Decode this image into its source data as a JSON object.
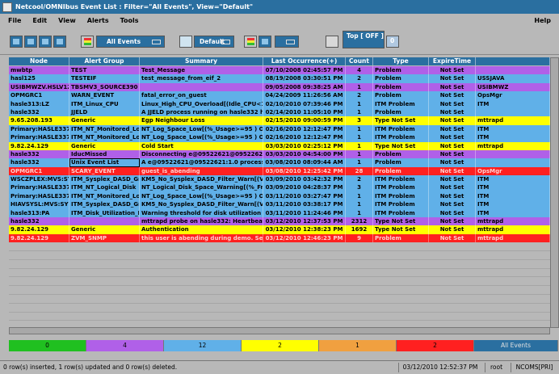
{
  "window": {
    "title": "Netcool/OMNIbus Event List : Filter=\"All Events\", View=\"Default\""
  },
  "menu": {
    "file": "File",
    "edit": "Edit",
    "view": "View",
    "alerts": "Alerts",
    "tools": "Tools",
    "help": "Help"
  },
  "toolbar": {
    "filter": "All Events",
    "view": "Default",
    "top": "Top [ OFF ]",
    "top_value": "0"
  },
  "colors": {
    "purple": "#b060e8",
    "blue": "#60b0e8",
    "yellow": "#ffff00",
    "orange": "#f0a040",
    "red": "#ff2020",
    "green": "#20c020",
    "header": "#2a6fa0"
  },
  "columns": [
    "Node",
    "Alert Group",
    "Summary",
    "Last Occurrence(+)",
    "Count",
    "Type",
    "ExpireTime",
    ""
  ],
  "rows": [
    {
      "sev": "purple",
      "node": "mwbtp",
      "group": "TEST",
      "summary": "Test_Message",
      "last": "07/10/2008 02:45:57 PM",
      "count": "4",
      "type": "Problem",
      "expire": "Not Set",
      "extra": ""
    },
    {
      "sev": "blue",
      "node": "hasl125",
      "group": "TESTEIF",
      "summary": "test_message_from_eif_2",
      "last": "08/19/2008 03:30:51 PM",
      "count": "2",
      "type": "Problem",
      "expire": "Not Set",
      "extra": "USSJAVA"
    },
    {
      "sev": "purple",
      "node": "USIBMWZV.HSLV12",
      "group": "TBSMV3_SOURCE390",
      "summary": "",
      "last": "09/05/2008 09:38:25 AM",
      "count": "1",
      "type": "Problem",
      "expire": "Not Set",
      "extra": "USIBMWZ"
    },
    {
      "sev": "blue",
      "node": "OPMGRC1",
      "group": "WARN_EVENT",
      "summary": "fatal_error_on_guest",
      "last": "04/24/2009 11:26:56 AM",
      "count": "2",
      "type": "Problem",
      "expire": "Not Set",
      "extra": "OpsMgr"
    },
    {
      "sev": "blue",
      "node": "hasle313:LZ",
      "group": "ITM_Linux_CPU",
      "summary": "Linux_High_CPU_Overload[(Idle_CPU<10.",
      "last": "02/10/2010 07:39:46 PM",
      "count": "1",
      "type": "ITM Problem",
      "expire": "Not Set",
      "extra": "ITM"
    },
    {
      "sev": "blue",
      "node": "hasle332",
      "group": "JJELD",
      "summary": "A JJELD process  running on hasle332 ha",
      "last": "02/14/2010 11:05:10 PM",
      "count": "1",
      "type": "Problem",
      "expire": "Not Set",
      "extra": ""
    },
    {
      "sev": "yellow",
      "node": "9.65.208.193",
      "group": "Generic",
      "summary": "Egp Neighbour Loss",
      "last": "02/15/2010 09:00:59 PM",
      "count": "3",
      "type": "Type Not Set",
      "expire": "Not Set",
      "extra": "mttrapd"
    },
    {
      "sev": "blue",
      "node": "Primary:HASLE337:",
      "group": "ITM_NT_Monitored_Log",
      "summary": "NT_Log_Space_Low[(%_Usage>=95 ) ON",
      "last": "02/16/2010 12:12:47 PM",
      "count": "1",
      "type": "ITM Problem",
      "expire": "Not Set",
      "extra": "ITM"
    },
    {
      "sev": "blue",
      "node": "Primary:HASLE337:",
      "group": "ITM_NT_Monitored_Log",
      "summary": "NT_Log_Space_Low[(%_Usage>=95 ) ON",
      "last": "02/16/2010 12:12:47 PM",
      "count": "1",
      "type": "ITM Problem",
      "expire": "Not Set",
      "extra": "ITM"
    },
    {
      "sev": "yellow",
      "node": "9.82.24.129",
      "group": "Generic",
      "summary": "Cold Start",
      "last": "03/03/2010 02:25:12 PM",
      "count": "1",
      "type": "Type Not Set",
      "expire": "Not Set",
      "extra": "mttrapd"
    },
    {
      "sev": "purple",
      "node": "hasle332",
      "group": "IducMissed",
      "summary": "Disconnecting e@09522621@09522621:1.",
      "last": "03/03/2010 04:54:00 PM",
      "count": "1",
      "type": "Problem",
      "expire": "Not Set",
      "extra": ""
    },
    {
      "sev": "blue",
      "node": "hasle332",
      "group": "Unix Event List",
      "summary": "A e@09522621@09522621:1.0 process e",
      "last": "03/08/2010 08:09:44 AM",
      "count": "1",
      "type": "Problem",
      "expire": "Not Set",
      "extra": ""
    },
    {
      "sev": "red",
      "node": "OPMGRC1",
      "group": "SCARY_EVENT",
      "summary": "guest_is_abending",
      "last": "03/08/2010 12:25:42 PM",
      "count": "28",
      "type": "Problem",
      "expire": "Not Set",
      "extra": "OpsMgr"
    },
    {
      "sev": "blue",
      "node": "WSCZPLEX:MVS:SY",
      "group": "ITM_Sysplex_DASD_Gr",
      "summary": "KM5_No_Sysplex_DASD_Filter_Warn[(Vol",
      "last": "03/09/2010 03:42:32 PM",
      "count": "2",
      "type": "ITM Problem",
      "expire": "Not Set",
      "extra": "ITM"
    },
    {
      "sev": "blue",
      "node": "Primary:HASLE337:",
      "group": "ITM_NT_Logical_Disk",
      "summary": "NT_Logical_Disk_Space_Warning[(%_Fre",
      "last": "03/09/2010 04:28:37 PM",
      "count": "3",
      "type": "ITM Problem",
      "expire": "Not Set",
      "extra": "ITM"
    },
    {
      "sev": "blue",
      "node": "Primary:HASLE337:",
      "group": "ITM_NT_Monitored_Log",
      "summary": "NT_Log_Space_Low[(%_Usage>=95 ) ON",
      "last": "03/11/2010 03:27:47 PM",
      "count": "1",
      "type": "ITM Problem",
      "expire": "Not Set",
      "extra": "ITM"
    },
    {
      "sev": "blue",
      "node": "HIAVSYSL:MVS:SY",
      "group": "ITM_Sysplex_DASD_Gr",
      "summary": "KM5_No_Sysplex_DASD_Filter_Warn[(Vol",
      "last": "03/11/2010 03:38:17 PM",
      "count": "1",
      "type": "ITM Problem",
      "expire": "Not Set",
      "extra": "ITM"
    },
    {
      "sev": "blue",
      "node": "hasle313:PA",
      "group": "ITM_Disk_Utilization_LT",
      "summary": "Warning threshold for disk utilization on o",
      "last": "03/11/2010 11:24:46 PM",
      "count": "1",
      "type": "ITM Problem",
      "expire": "Not Set",
      "extra": "ITM"
    },
    {
      "sev": "purple",
      "node": "hasle332",
      "group": "",
      "summary": "mttrapd probe on hasle332: Heartbeat Me",
      "last": "03/12/2010 12:37:53 PM",
      "count": "2312",
      "type": "Type Not Set",
      "expire": "Not Set",
      "extra": "mttrapd"
    },
    {
      "sev": "yellow",
      "node": "9.82.24.129",
      "group": "Generic",
      "summary": "Authentication",
      "last": "03/12/2010 12:38:23 PM",
      "count": "1692",
      "type": "Type Not Set",
      "expire": "Not Set",
      "extra": "mttrapd"
    },
    {
      "sev": "red",
      "node": "9.82.24.129",
      "group": "ZVM_SNMP",
      "summary": " this user is abending during demo. Seno",
      "last": "03/12/2010 12:46:23 PM",
      "count": "9",
      "type": "Problem",
      "expire": "Not Set",
      "extra": "mttrapd"
    }
  ],
  "summary_bar": [
    {
      "label": "0",
      "color": "#20c020"
    },
    {
      "label": "4",
      "color": "#b060e8"
    },
    {
      "label": "12",
      "color": "#60b0e8"
    },
    {
      "label": "2",
      "color": "#ffff00"
    },
    {
      "label": "1",
      "color": "#f0a040"
    },
    {
      "label": "2",
      "color": "#ff2020"
    },
    {
      "label": "All Events",
      "color": "#2a6fa0"
    }
  ],
  "status": {
    "message": "0 row(s) inserted, 1 row(s) updated and 0 row(s) deleted.",
    "time": "03/12/2010 12:52:37 PM",
    "user": "root",
    "server": "NCOMS[PRI]"
  }
}
